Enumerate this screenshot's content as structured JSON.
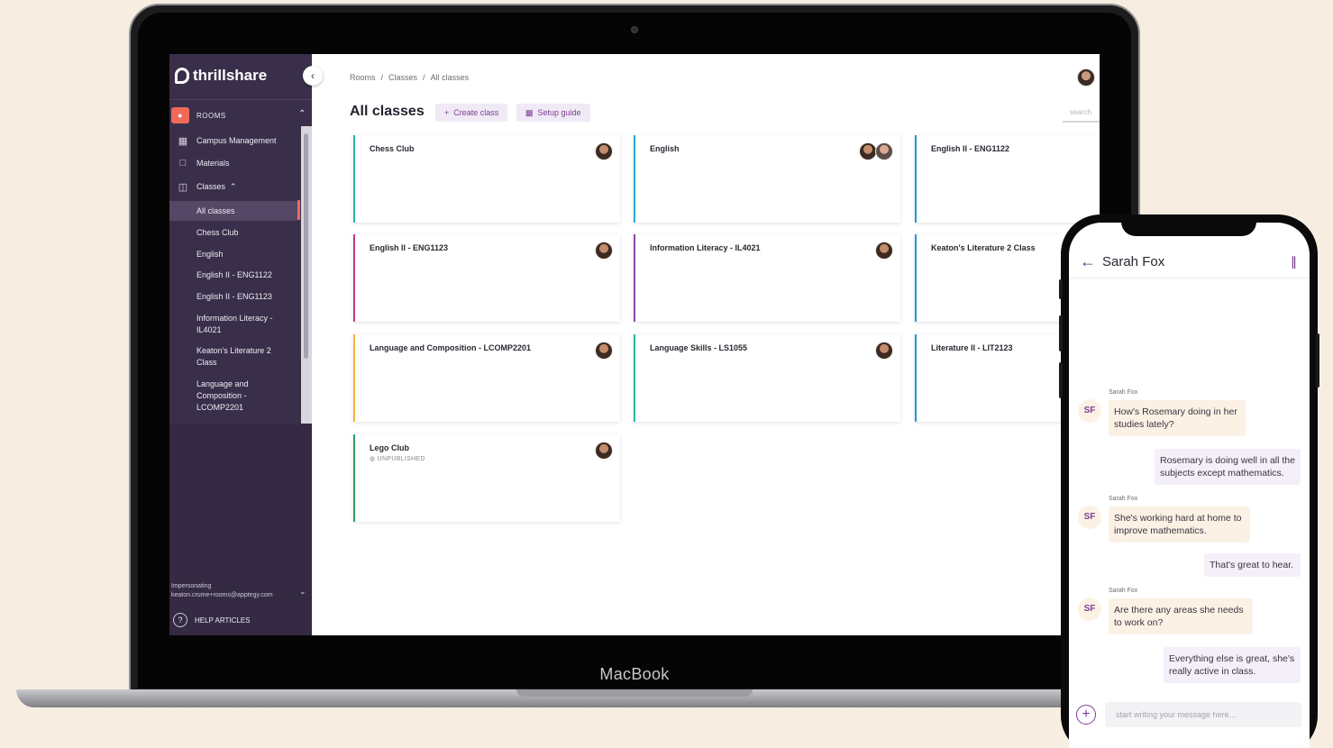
{
  "laptop": {
    "brand": "MacBook"
  },
  "app": {
    "name": "thrillshare",
    "sidebar": {
      "rooms_label": "ROOMS",
      "nav": [
        {
          "label": "Campus Management",
          "icon": "campus-icon"
        },
        {
          "label": "Materials",
          "icon": "folder-icon"
        },
        {
          "label": "Classes",
          "icon": "book-icon"
        }
      ],
      "classes": [
        "All classes",
        "Chess Club",
        "English",
        "English II - ENG1122",
        "English II - ENG1123",
        "Information Literacy - IL4021",
        "Keaton's Literature 2 Class",
        "Language and Composition - LCOMP2201"
      ],
      "impersonating_label": "Impersonating",
      "impersonating_email": "keaton.crume+rooms@apptegy.com",
      "help_label": "HELP ARTICLES"
    },
    "breadcrumb": [
      "Rooms",
      "Classes",
      "All classes"
    ],
    "page_title": "All classes",
    "create_class_label": "Create class",
    "setup_guide_label": "Setup guide",
    "search_placeholder": "search",
    "cards": [
      {
        "title": "Chess Club",
        "color": "#2bb7a4"
      },
      {
        "title": "English",
        "color": "#29a9dc"
      },
      {
        "title": "English II - ENG1122",
        "color": "#2196e0"
      },
      {
        "title": "English II - ENG1123",
        "color": "#c2368a"
      },
      {
        "title": "Information Literacy - IL4021",
        "color": "#8e44ad"
      },
      {
        "title": "Keaton's Literature 2 Class",
        "color": "#2196e0"
      },
      {
        "title": "Language and Composition - LCOMP2201",
        "color": "#f4b542"
      },
      {
        "title": "Language Skills - LS1055",
        "color": "#2bb7a4"
      },
      {
        "title": "Literature II - LIT2123",
        "color": "#2196e0"
      },
      {
        "title": "Lego Club",
        "color": "#2f9e64",
        "status": "UNPUBLISHED"
      }
    ]
  },
  "phone": {
    "chat_title": "Sarah Fox",
    "sender_initials": "SF",
    "messages": [
      {
        "from": "Sarah Fox",
        "text": "How's Rosemary doing in her studies lately?",
        "dir": "in"
      },
      {
        "text": "Rosemary is doing well in all the subjects except mathematics.",
        "dir": "out"
      },
      {
        "from": "Sarah Fox",
        "text": "She's working hard at home to improve mathematics.",
        "dir": "in"
      },
      {
        "text": "That's great to hear.",
        "dir": "out"
      },
      {
        "from": "Sarah Fox",
        "text": "Are there any areas she needs to work on?",
        "dir": "in"
      },
      {
        "text": "Everything else is great, she's really active in class.",
        "dir": "out"
      }
    ],
    "composer_placeholder": "start writing your message here..."
  }
}
